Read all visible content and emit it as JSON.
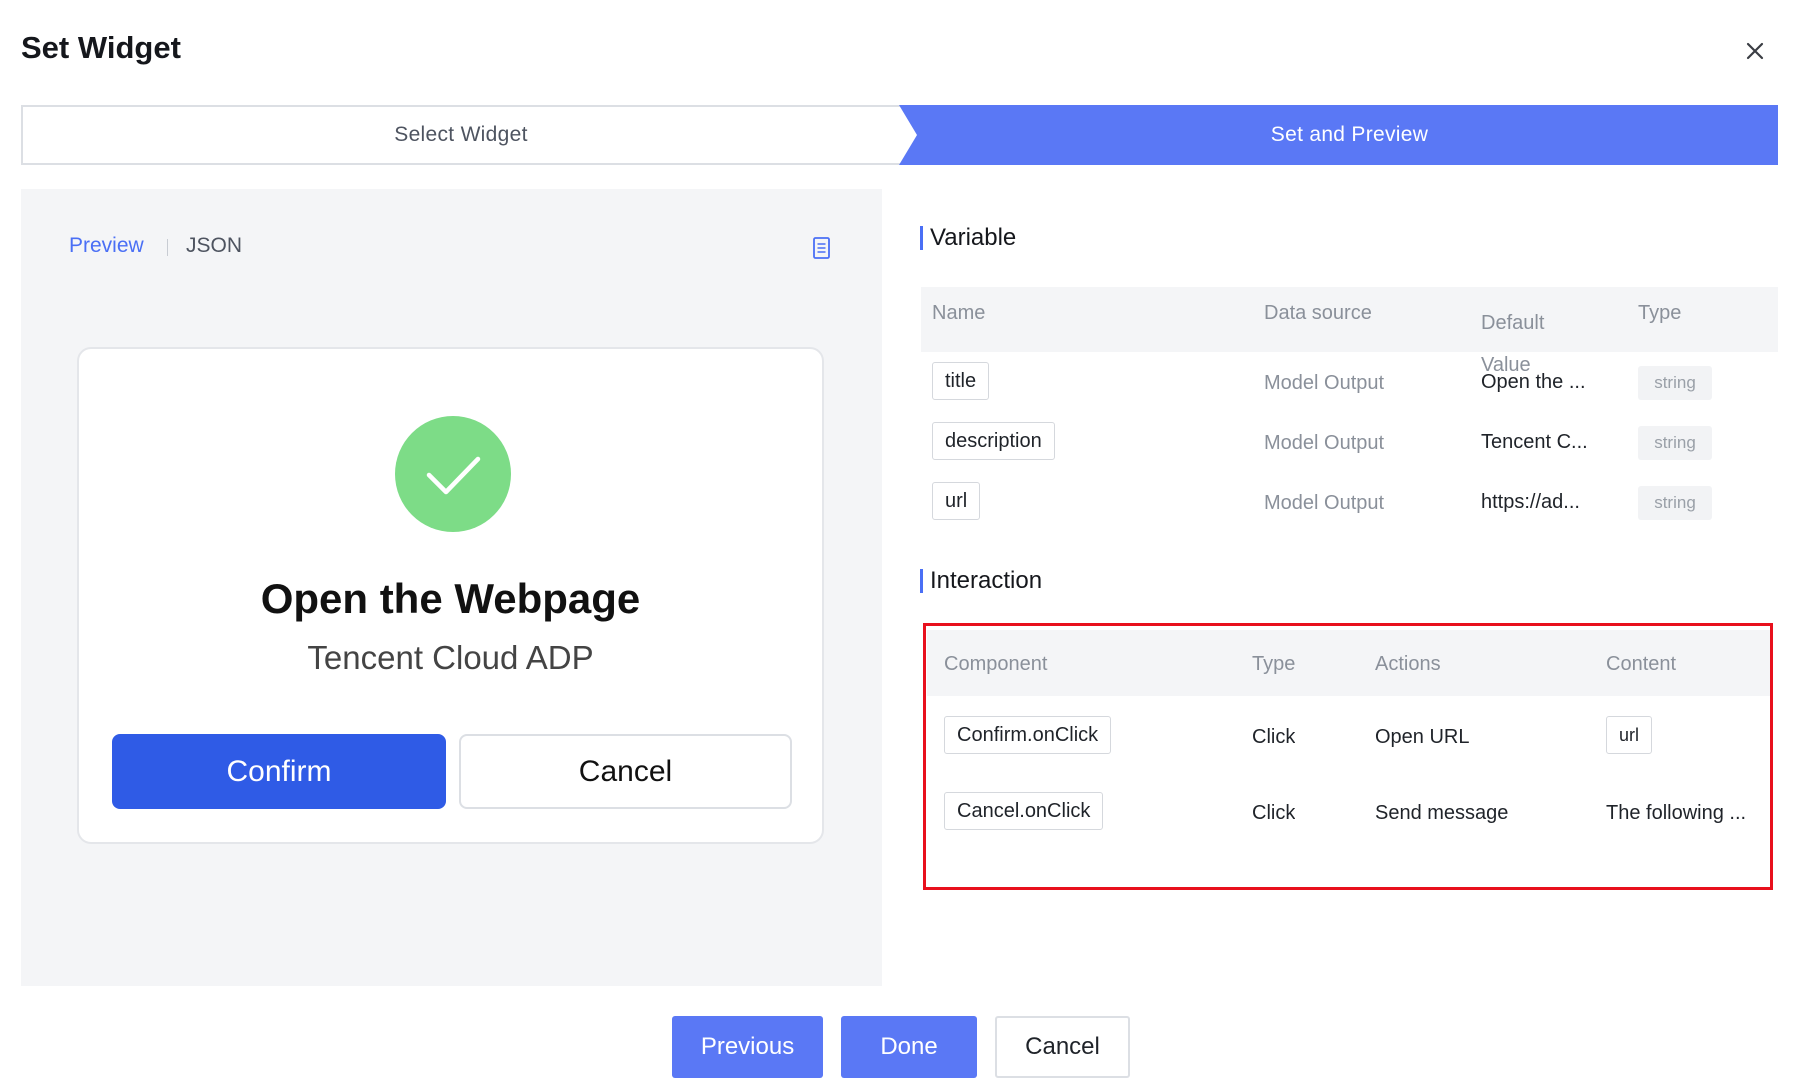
{
  "dialog": {
    "title": "Set Widget"
  },
  "steps": [
    {
      "label": "Select Widget",
      "active": false
    },
    {
      "label": "Set and Preview",
      "active": true
    }
  ],
  "preview_panel": {
    "tabs": [
      {
        "label": "Preview",
        "active": true
      },
      {
        "label": "JSON",
        "active": false
      }
    ],
    "widget": {
      "title": "Open the Webpage",
      "description": "Tencent Cloud ADP",
      "confirm_label": "Confirm",
      "cancel_label": "Cancel"
    }
  },
  "variable": {
    "heading": "Variable",
    "columns": [
      "Name",
      "Data source",
      "Default Value",
      "Type"
    ],
    "rows": [
      {
        "name": "title",
        "source": "Model Output",
        "default": "Open the ...",
        "type": "string"
      },
      {
        "name": "description",
        "source": "Model Output",
        "default": "Tencent C...",
        "type": "string"
      },
      {
        "name": "url",
        "source": "Model Output",
        "default": "https://ad...",
        "type": "string"
      }
    ]
  },
  "interaction": {
    "heading": "Interaction",
    "columns": [
      "Component",
      "Type",
      "Actions",
      "Content"
    ],
    "rows": [
      {
        "component": "Confirm.onClick",
        "type": "Click",
        "action": "Open URL",
        "content": "url",
        "content_is_tag": true
      },
      {
        "component": "Cancel.onClick",
        "type": "Click",
        "action": "Send message",
        "content": "The following ...",
        "content_is_tag": false
      }
    ]
  },
  "footer": {
    "previous_label": "Previous",
    "done_label": "Done",
    "cancel_label": "Cancel"
  },
  "icons": {
    "close": "close-icon",
    "document": "document-icon",
    "success": "check-circle-icon"
  },
  "colors": {
    "accent": "#4a6ff5",
    "step_active": "#5a78f5",
    "widget_primary": "#2f5be6",
    "success_green": "#7ddc87",
    "highlight_red": "#e8101d"
  }
}
